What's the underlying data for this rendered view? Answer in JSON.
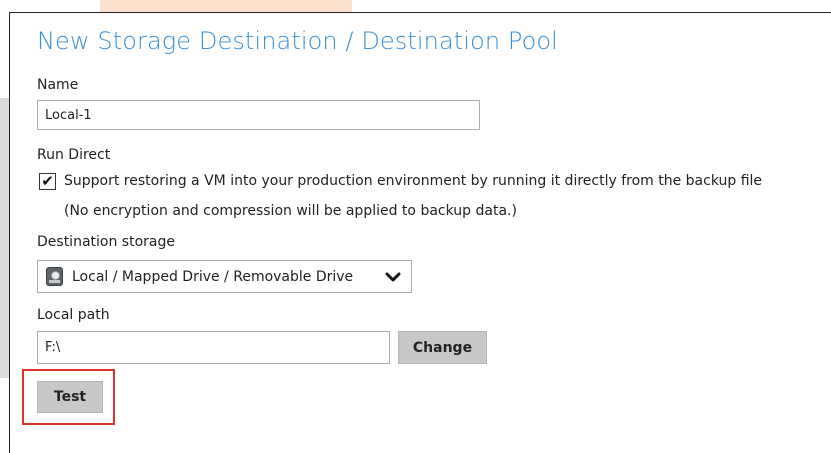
{
  "dialog": {
    "title": "New Storage Destination / Destination Pool"
  },
  "name_field": {
    "label": "Name",
    "value": "Local-1"
  },
  "run_direct": {
    "label": "Run Direct",
    "checked": true,
    "checkbox_label": "Support restoring a VM into your production environment by running it directly from the backup file",
    "note": "(No encryption and compression will be applied to backup data.)"
  },
  "destination_storage": {
    "label": "Destination storage",
    "selected": "Local / Mapped Drive / Removable Drive",
    "icon": "hard-drive-icon"
  },
  "local_path": {
    "label": "Local path",
    "value": "F:\\",
    "change_label": "Change"
  },
  "test_button": {
    "label": "Test"
  },
  "colors": {
    "title": "#3a8fd6",
    "button_bg": "#c8c8c8",
    "highlight": "#e2302a"
  }
}
